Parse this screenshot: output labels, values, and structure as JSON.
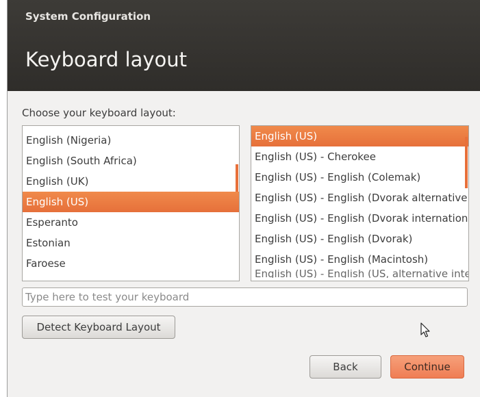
{
  "header": {
    "subtitle": "System Configuration",
    "title": "Keyboard layout"
  },
  "choose_label": "Choose your keyboard layout:",
  "layouts": [
    "English (Nigeria)",
    "English (South Africa)",
    "English (UK)",
    "English (US)",
    "Esperanto",
    "Estonian",
    "Faroese"
  ],
  "selected_layout": "English (US)",
  "variants": [
    "English (US)",
    "English (US) - Cherokee",
    "English (US) - English (Colemak)",
    "English (US) - English (Dvorak alternative international no dead keys)",
    "English (US) - English (Dvorak international with dead keys)",
    "English (US) - English (Dvorak)",
    "English (US) - English (Macintosh)",
    "English (US) - English (US, alternative international)"
  ],
  "selected_variant": "English (US)",
  "test_input": {
    "placeholder": "Type here to test your keyboard",
    "value": ""
  },
  "detect_label": "Detect Keyboard Layout",
  "back_label": "Back",
  "continue_label": "Continue",
  "colors": {
    "accent": "#e6703a",
    "header_bg": "#3d3b37"
  }
}
